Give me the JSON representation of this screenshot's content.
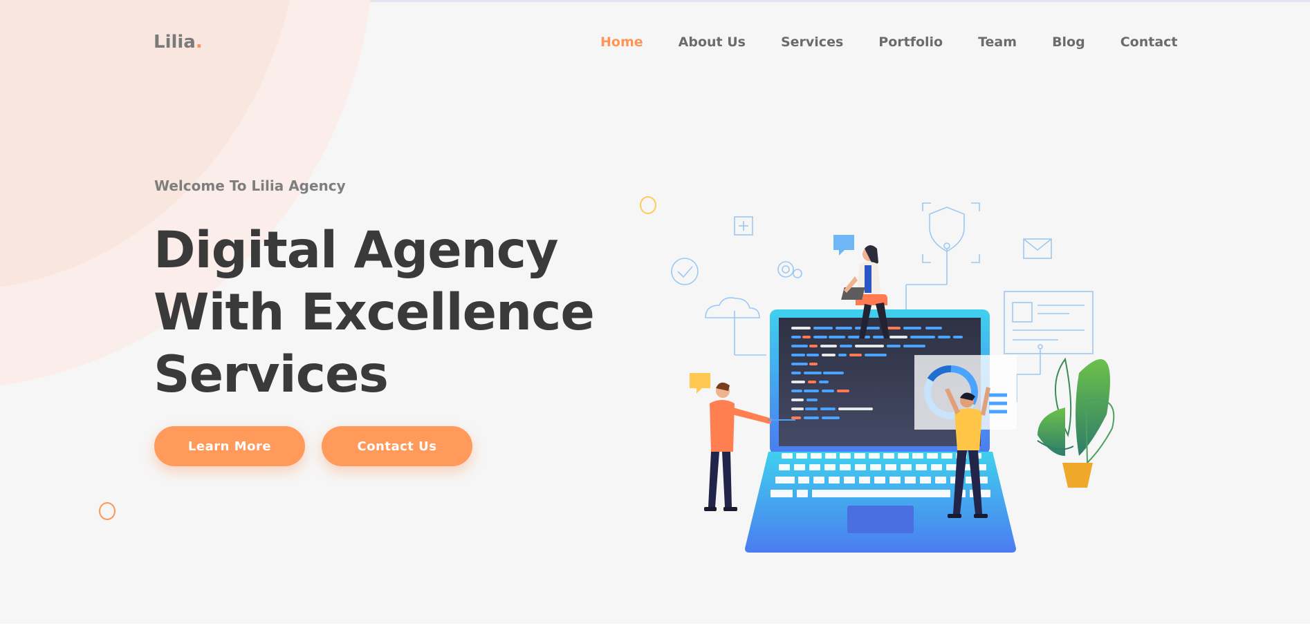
{
  "brand": {
    "name": "Lilia",
    "dot": ".",
    "accent_color": "#ff9554"
  },
  "nav": {
    "items": [
      "Home",
      "About Us",
      "Services",
      "Portfolio",
      "Team",
      "Blog",
      "Contact"
    ],
    "active": "Home"
  },
  "hero": {
    "welcome": "Welcome To Lilia Agency",
    "headline_lines": [
      "Digital Agency",
      "With Excellence",
      "Services"
    ],
    "buttons": {
      "learn_more": "Learn More",
      "contact_us": "Contact Us"
    }
  },
  "illustration": {
    "name": "laptop-team-illustration"
  }
}
